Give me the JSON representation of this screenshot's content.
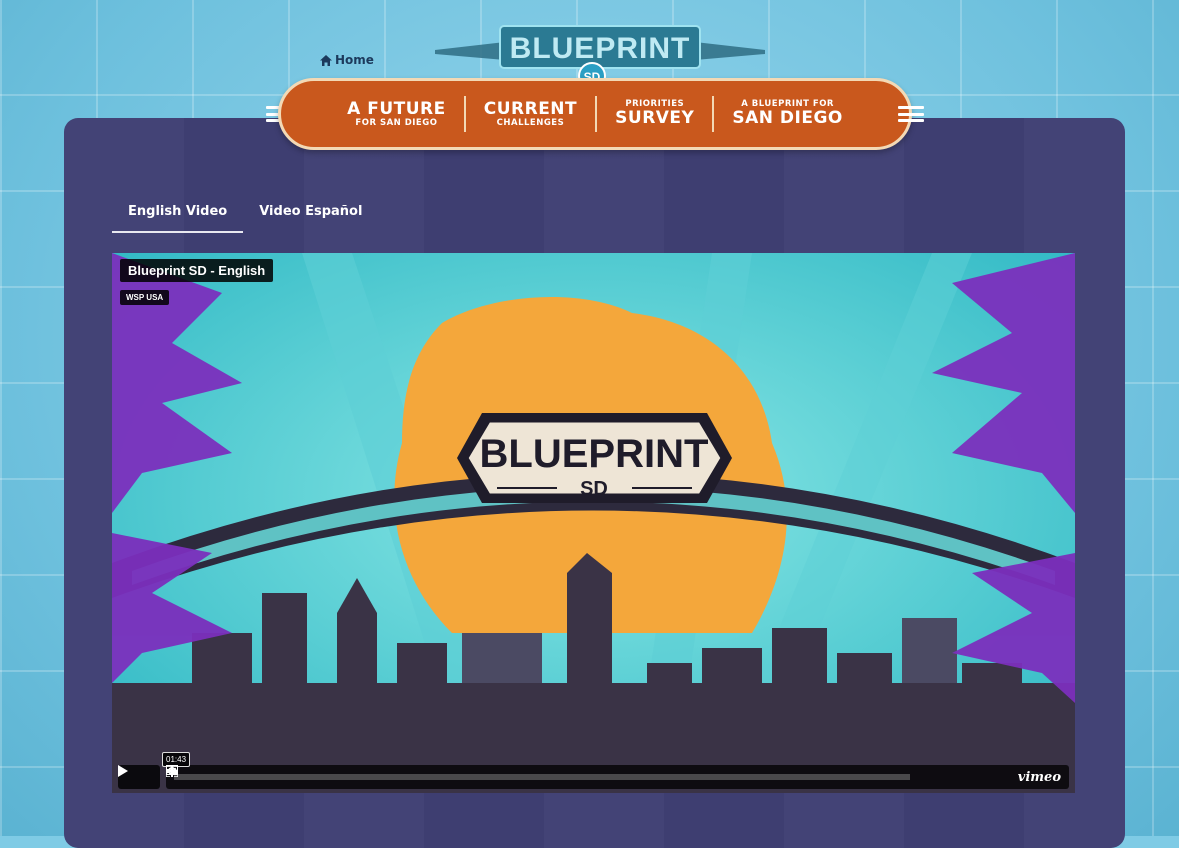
{
  "header": {
    "home_label": "Home",
    "logo_text": "BLUEPRINT",
    "logo_badge": "SD"
  },
  "nav": [
    {
      "line1": "A FUTURE",
      "line2": "FOR SAN DIEGO"
    },
    {
      "line1": "CURRENT",
      "line2": "CHALLENGES"
    },
    {
      "line1": "PRIORITIES",
      "line2": "SURVEY"
    },
    {
      "line1": "A BLUEPRINT FOR",
      "line2": "SAN DIEGO"
    }
  ],
  "tabs": [
    {
      "label": "English Video",
      "active": true
    },
    {
      "label": "Video Español",
      "active": false
    }
  ],
  "video": {
    "title": "Blueprint SD - English",
    "byline": "WSP USA",
    "logo_text": "BLUEPRINT",
    "logo_sub": "SD",
    "time": "01:43",
    "progress": 0.0,
    "provider": "vimeo"
  },
  "colors": {
    "nav_orange": "#c9581d",
    "panel": "#3f3f73",
    "sun": "#f4a73b",
    "palm": "#7b2fbd",
    "sky": "#4fd1d6",
    "skyline": "#3a3346"
  },
  "icons": [
    "home-icon",
    "menu-icon",
    "play-icon",
    "volume-icon",
    "captions-icon",
    "settings-icon",
    "pip-icon",
    "fullscreen-icon"
  ]
}
